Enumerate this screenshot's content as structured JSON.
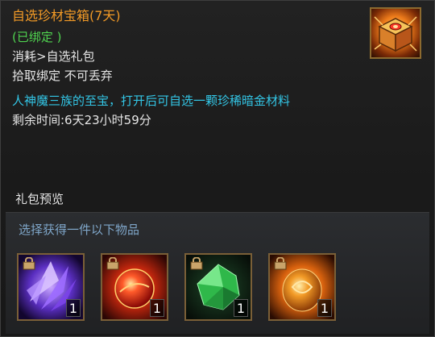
{
  "item": {
    "name": "自选珍材宝箱(7天)",
    "bound_status": "(已绑定 )",
    "consume": "消耗>自选礼包",
    "pickup_rule": "拾取绑定 不可丢弃",
    "description": "人神魔三族的至宝，打开后可自选一颗珍稀暗金材料",
    "remaining_time": "剩余时间:6天23小时59分"
  },
  "preview": {
    "title": "礼包预览",
    "subtitle": "选择获得一件以下物品",
    "rewards": [
      {
        "icon": "purple-crystal-icon",
        "count": "1",
        "color": "#7a48e0"
      },
      {
        "icon": "red-orb-icon",
        "count": "1",
        "color": "#e03a1a"
      },
      {
        "icon": "green-gem-icon",
        "count": "1",
        "color": "#2fb84a"
      },
      {
        "icon": "orange-orb-icon",
        "count": "1",
        "color": "#e88a1c"
      }
    ]
  },
  "colors": {
    "name": "#f29a26",
    "bound": "#4fd34f",
    "description": "#33c6e6",
    "subtitle": "#7fa6c9"
  }
}
